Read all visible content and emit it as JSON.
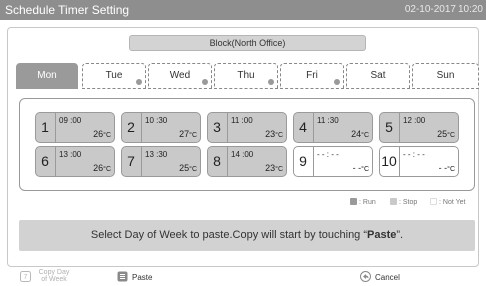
{
  "header": {
    "title": "Schedule Timer Setting",
    "date": "02-10-2017",
    "time": "10:20"
  },
  "block_selector": "Block(North Office)",
  "days": [
    {
      "label": "Mon",
      "active": true,
      "dot": false
    },
    {
      "label": "Tue",
      "active": false,
      "dot": true
    },
    {
      "label": "Wed",
      "active": false,
      "dot": true
    },
    {
      "label": "Thu",
      "active": false,
      "dot": true
    },
    {
      "label": "Fri",
      "active": false,
      "dot": true
    },
    {
      "label": "Sat",
      "active": false,
      "dot": false
    },
    {
      "label": "Sun",
      "active": false,
      "dot": false
    }
  ],
  "slots": [
    {
      "num": "1",
      "time": "09 :00",
      "temp": "26",
      "unit": "°C",
      "state": "run"
    },
    {
      "num": "2",
      "time": "10 :30",
      "temp": "27",
      "unit": "°C",
      "state": "run"
    },
    {
      "num": "3",
      "time": "11 :00",
      "temp": "23",
      "unit": "°C",
      "state": "run"
    },
    {
      "num": "4",
      "time": "11 :30",
      "temp": "24",
      "unit": "°C",
      "state": "run"
    },
    {
      "num": "5",
      "time": "12 :00",
      "temp": "25",
      "unit": "°C",
      "state": "run"
    },
    {
      "num": "6",
      "time": "13 :00",
      "temp": "26",
      "unit": "°C",
      "state": "run"
    },
    {
      "num": "7",
      "time": "13 :30",
      "temp": "25",
      "unit": "°C",
      "state": "run"
    },
    {
      "num": "8",
      "time": "14 :00",
      "temp": "23",
      "unit": "°C",
      "state": "run"
    },
    {
      "num": "9",
      "time": "- - : - -",
      "temp": "- -",
      "unit": "°C",
      "state": "empty"
    },
    {
      "num": "10",
      "time": "- - : - -",
      "temp": "- -",
      "unit": "°C",
      "state": "empty"
    }
  ],
  "legend": {
    "run": "Run",
    "stop": "Stop",
    "not_yet": "Not Yet"
  },
  "message": {
    "prefix": "Select Day of Week to paste.Copy will start by touching “",
    "keyword": "Paste",
    "suffix": "”."
  },
  "bottom": {
    "copy_day": "Copy Day of Week",
    "paste": "Paste",
    "cancel": "Cancel"
  },
  "colors": {
    "header_bg": "#8e8e8e",
    "slot_run": "#c9c9c9",
    "slot_empty": "#ffffff",
    "tab_active": "#9a9a9a",
    "legend_run": "#9a9a9a",
    "legend_stop": "#c9c9c9",
    "legend_not_yet": "#ffffff"
  },
  "icons": {
    "copy": "copy-day-icon",
    "paste": "paste-icon",
    "cancel": "cancel-icon"
  }
}
